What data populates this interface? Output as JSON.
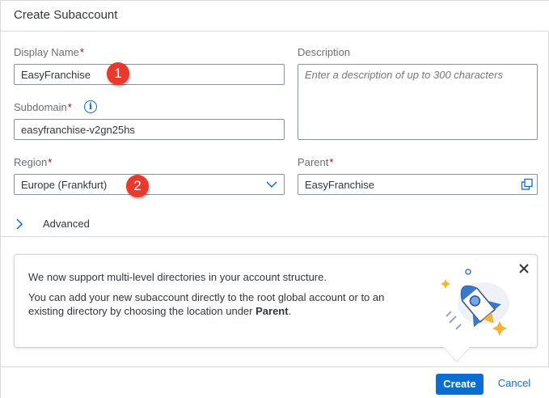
{
  "dialog": {
    "title": "Create Subaccount"
  },
  "form": {
    "display_name": {
      "label": "Display Name",
      "required": "*",
      "value": "EasyFranchise"
    },
    "description": {
      "label": "Description",
      "placeholder": "Enter a description of up to 300 characters"
    },
    "subdomain": {
      "label": "Subdomain",
      "required": "*",
      "info_icon": "i",
      "value": "easyfranchise-v2gn25hs"
    },
    "region": {
      "label": "Region",
      "required": "*",
      "value": "Europe (Frankfurt)"
    },
    "parent": {
      "label": "Parent",
      "required": "*",
      "value": "EasyFranchise"
    },
    "advanced": {
      "label": "Advanced"
    }
  },
  "annotations": {
    "badge_1": "1",
    "badge_2": "2"
  },
  "info_panel": {
    "line1": "We now support multi-level directories in your account structure.",
    "line2_prefix": "You can add your new subaccount directly to the root global account or to an existing directory by choosing the location under ",
    "line2_bold": "Parent",
    "line2_suffix": "."
  },
  "footer": {
    "create_label": "Create",
    "cancel_label": "Cancel"
  },
  "icons": {
    "info": "info-icon",
    "dropdown": "chevron-down-icon",
    "value_help": "value-help-icon",
    "expand": "chevron-right-icon",
    "close": "close-icon",
    "illustration": "rocket-illustration"
  },
  "colors": {
    "accent": "#0a6ed1",
    "required": "#bb0000",
    "badge": "#e8392c"
  }
}
